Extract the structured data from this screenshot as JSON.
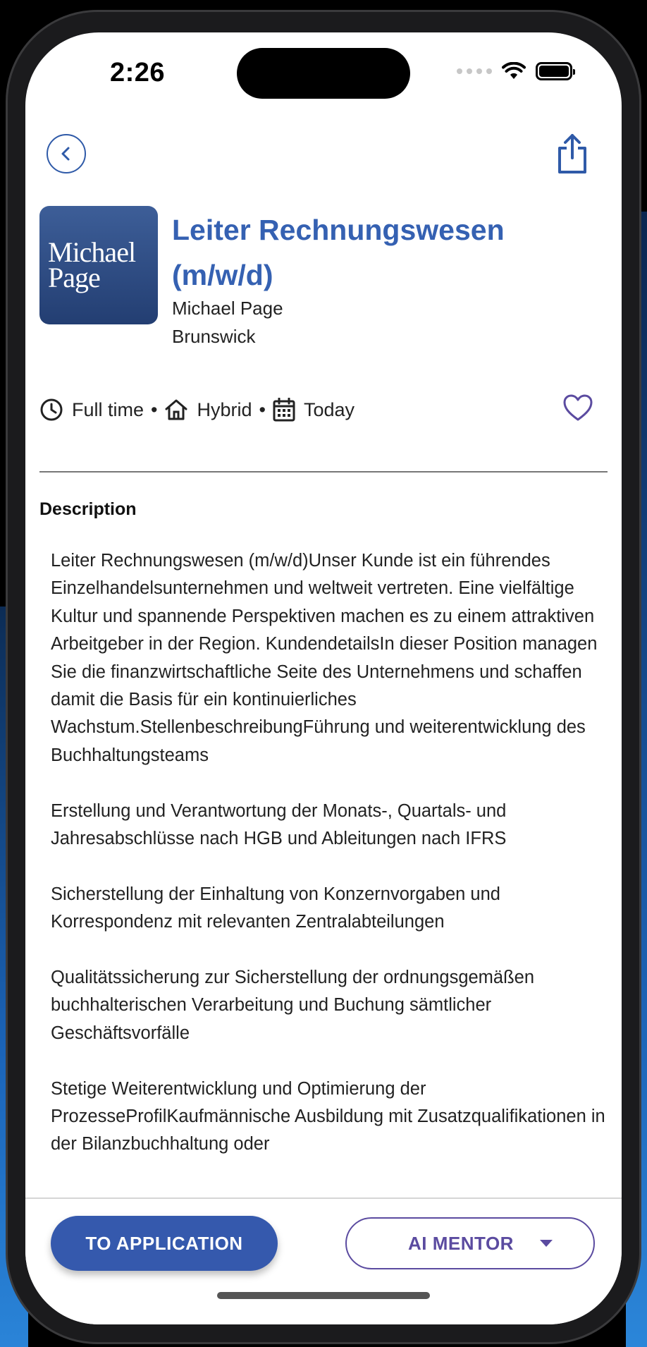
{
  "status_bar": {
    "time": "2:26"
  },
  "job": {
    "logo_text_line1": "Michael",
    "logo_text_line2": "Page",
    "title": "Leiter Rechnungswesen (m/w/d)",
    "company": "Michael Page",
    "location": "Brunswick",
    "employment_type": "Full time",
    "work_mode": "Hybrid",
    "posted": "Today",
    "separator": "•"
  },
  "description": {
    "label": "Description",
    "paragraphs": [
      "Leiter Rechnungswesen (m/w/d)Unser Kunde ist ein führendes Einzelhandelsunternehmen und weltweit vertreten. Eine vielfältige Kultur und spannende Perspektiven machen es zu einem attraktiven Arbeitgeber in der Region. KundendetailsIn dieser Position managen Sie die finanzwirtschaftliche Seite des Unternehmens und schaffen damit die Basis für ein kontinuierliches Wachstum.StellenbeschreibungFührung und weiterentwicklung des Buchhaltungsteams",
      "Erstellung und Verantwortung der Monats-, Quartals- und Jahresabschlüsse nach HGB und Ableitungen nach IFRS",
      "Sicherstellung der Einhaltung von Konzernvorgaben und Korrespondenz mit relevanten Zentralabteilungen",
      "Qualitätssicherung zur Sicherstellung der ordnungsgemäßen buchhalterischen Verarbeitung und Buchung sämtlicher Geschäftsvorfälle",
      "Stetige Weiterentwicklung und Optimierung der ProzesseProfilKaufmännische Ausbildung mit Zusatzqualifikationen in der Bilanzbuchhaltung oder"
    ]
  },
  "actions": {
    "apply_label": "TO APPLICATION",
    "mentor_label": "AI MENTOR"
  },
  "colors": {
    "title_blue": "#3561b2",
    "apply_bg": "#3559ad",
    "mentor_purple": "#5b4ba0",
    "heart_purple": "#5b4ba0"
  }
}
